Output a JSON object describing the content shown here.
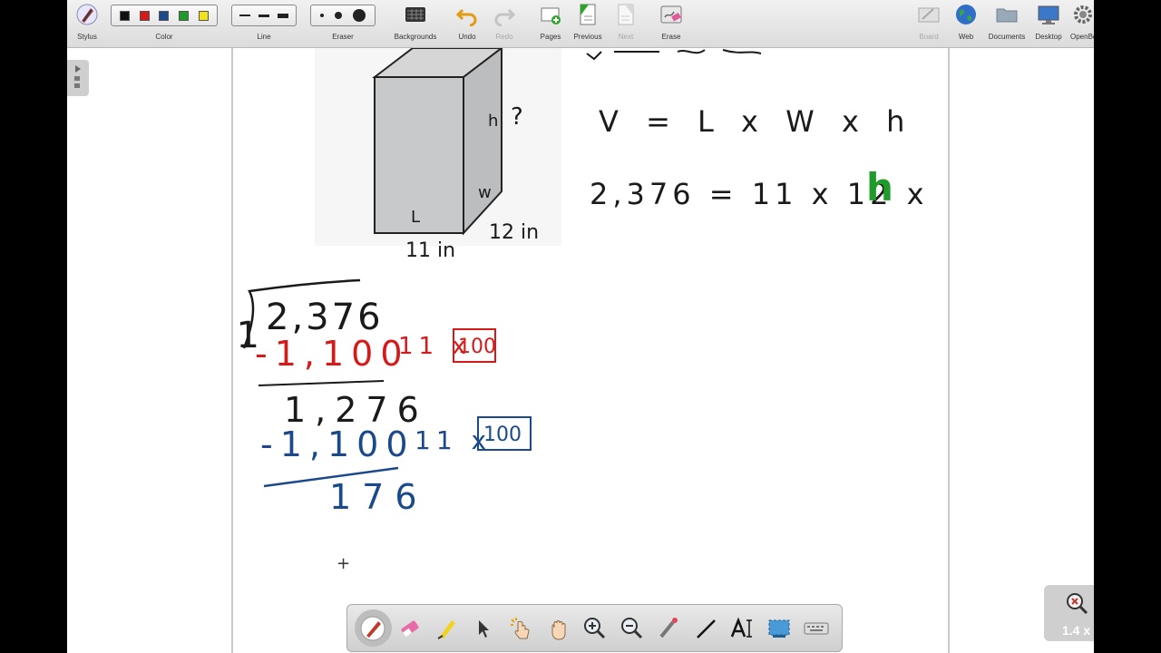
{
  "toolbar": {
    "stylus": "Stylus",
    "color": "Color",
    "line": "Line",
    "eraser": "Eraser",
    "backgrounds": "Backgrounds",
    "undo": "Undo",
    "redo": "Redo",
    "pages": "Pages",
    "previous": "Previous",
    "next": "Next",
    "erase": "Erase",
    "board": "Board",
    "web": "Web",
    "documents": "Documents",
    "desktop": "Desktop",
    "openboard": "OpenBo"
  },
  "colors": {
    "black": "#111111",
    "red": "#d61a1a",
    "blue": "#1b4a8c",
    "green": "#1e9b2a",
    "yellow": "#f2e21c"
  },
  "ink": {
    "box_h_label": "h",
    "box_question": "?",
    "box_w_label": "w",
    "box_l_label": "L",
    "dim_length": "11 in",
    "dim_width": "12 in",
    "formula": "V = L x W x h",
    "equation": "2,376 = 11 x 12 x",
    "equation_h": "h",
    "divisor": "11",
    "dividend": "2,376",
    "sub1": "-1,100",
    "mult1": "11 x",
    "box1": "100",
    "rem1": "1,276",
    "sub2": "-1,100",
    "mult2": "11 x",
    "box2": "100",
    "rem2": "176",
    "cursor": "+"
  },
  "zoom": "1.4 x",
  "bottom_tools": [
    "pen",
    "eraser",
    "highlighter",
    "selector",
    "interactor",
    "hand",
    "zoom-in",
    "zoom-out",
    "laser",
    "line",
    "text",
    "capture",
    "keyboard"
  ]
}
